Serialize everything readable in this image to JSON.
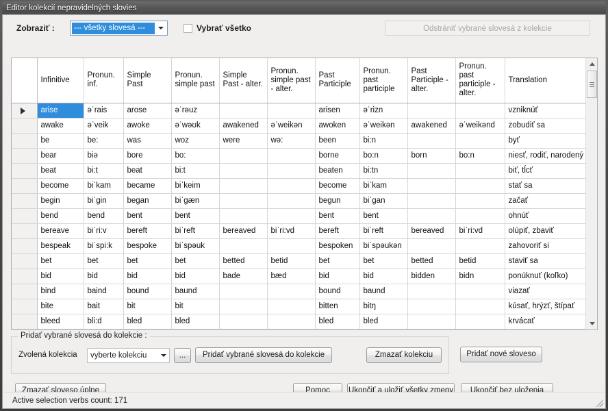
{
  "window": {
    "title": "Editor kolekcií nepravidelných slovies"
  },
  "toolbar": {
    "display_label": "Zobraziť  :",
    "display_selected": "--- všetky slovesá ---",
    "select_all_label": "Vybrať všetko",
    "select_all_checked": false,
    "remove_button_label": "Odstrániť vybrané slovesá z kolekcie",
    "remove_button_disabled": true
  },
  "grid": {
    "columns": [
      "",
      "Infinitive",
      "Pronun. inf.",
      "Simple Past",
      "Pronun. simple past",
      "Simple Past - alter.",
      "Pronun. simple past - alter.",
      "Past Participle",
      "Pronun. past participle",
      "Past Participle - alter.",
      "Pronun. past participle - alter.",
      "Translation"
    ],
    "selected_row": 0,
    "selected_column": 1,
    "rows": [
      [
        "arise",
        "əˈrais",
        "arose",
        "əˈrəuz",
        "",
        "",
        "arisen",
        "əˈrizn",
        "",
        "",
        "vzniknúť"
      ],
      [
        "awake",
        "əˈveik",
        "awoke",
        "əˈwəʊk",
        "awakened",
        "əˈweikən",
        "awoken",
        "əˈweikən",
        "awakened",
        "əˈweikənd",
        "zobudiť sa"
      ],
      [
        "be",
        "be:",
        "was",
        "woz",
        "were",
        "wə:",
        "been",
        "bi:n",
        "",
        "",
        "byť"
      ],
      [
        "bear",
        "biə",
        "bore",
        "bo:",
        "",
        "",
        "borne",
        "bo:n",
        "born",
        "bo:n",
        "niesť, rodiť, narodený"
      ],
      [
        "beat",
        "bi:t",
        "beat",
        "bi:t",
        "",
        "",
        "beaten",
        "bi:tn",
        "",
        "",
        "biť, tĺcť"
      ],
      [
        "become",
        "biˈkam",
        "became",
        "biˈkeim",
        "",
        "",
        "become",
        "biˈkam",
        "",
        "",
        "stať sa"
      ],
      [
        "begin",
        "biˈgin",
        "began",
        "biˈgæn",
        "",
        "",
        "begun",
        "biˈgan",
        "",
        "",
        "začať"
      ],
      [
        "bend",
        "bend",
        "bent",
        "bent",
        "",
        "",
        "bent",
        "bent",
        "",
        "",
        "ohnúť"
      ],
      [
        "bereave",
        "biˈri:v",
        "bereft",
        "biˈreft",
        "bereaved",
        "biˈri:vd",
        "bereft",
        "biˈreft",
        "bereaved",
        "biˈri:vd",
        "olúpiť, zbaviť"
      ],
      [
        "bespeak",
        "biˈspi:k",
        "bespoke",
        "biˈspəuk",
        "",
        "",
        "bespoken",
        "biˈspəukən",
        "",
        "",
        "zahovoriť si"
      ],
      [
        "bet",
        "bet",
        "bet",
        "bet",
        "betted",
        "betid",
        "bet",
        "bet",
        "betted",
        "betid",
        "staviť sa"
      ],
      [
        "bid",
        "bid",
        "bid",
        "bid",
        "bade",
        "bæd",
        "bid",
        "bid",
        "bidden",
        "bidn",
        "ponúknuť (koľko)"
      ],
      [
        "bind",
        "baind",
        "bound",
        "baund",
        "",
        "",
        "bound",
        "baund",
        "",
        "",
        "viazať"
      ],
      [
        "bite",
        "bait",
        "bit",
        "bit",
        "",
        "",
        "bitten",
        "bitŋ",
        "",
        "",
        "kúsať, hrýzť, štípať"
      ],
      [
        "bleed",
        "bli:d",
        "bled",
        "bled",
        "",
        "",
        "bled",
        "bled",
        "",
        "",
        "krvácať"
      ]
    ]
  },
  "group": {
    "legend": "Pridať vybrané slovesá do kolekcie :",
    "collection_label": "Zvolená kolekcia",
    "collection_selected": "vyberte kolekciu",
    "browse_button_label": "...",
    "add_selected_button_label": "Pridať vybrané slovesá do kolekcie",
    "delete_collection_button_label": "Zmazať kolekciu"
  },
  "buttons": {
    "add_new_verb": "Pridať nové sloveso",
    "delete_verb_completely": "Zmazať sloveso úplne",
    "help": "Pomoc",
    "save_and_exit": "Ukončiť a uložiť všetky zmeny",
    "exit_without_save": "Ukončiť bez uloženia"
  },
  "status": {
    "text": "Active selection verbs count: 171"
  },
  "colors": {
    "selection": "#2f8ddb",
    "window_chrome": "#4a4a4a",
    "client_bg": "#f0efee"
  }
}
